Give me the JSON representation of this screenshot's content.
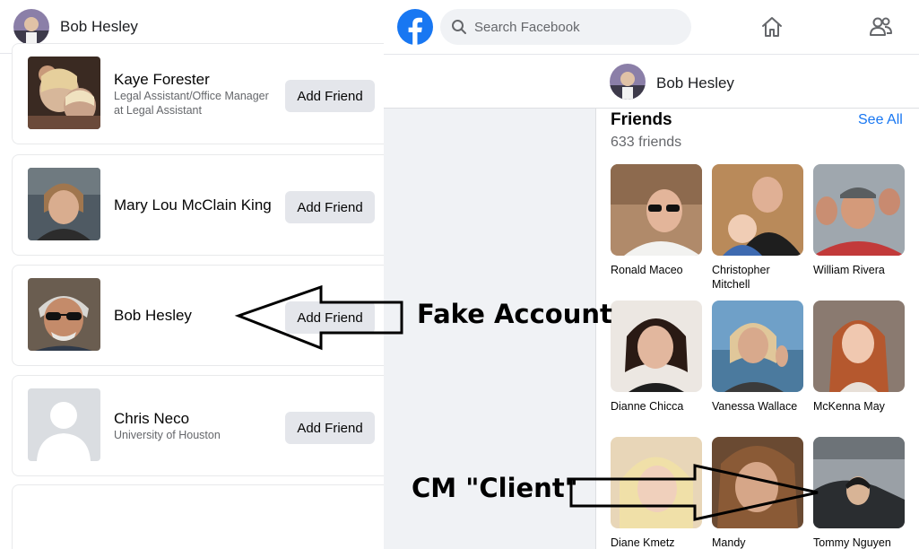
{
  "left_panel": {
    "header": {
      "name": "Bob Hesley"
    },
    "suggestions": [
      {
        "name": "Kaye Forester",
        "subtitle": "Legal Assistant/Office Manager at Legal Assistant",
        "button": "Add Friend"
      },
      {
        "name": "Mary Lou McClain King",
        "subtitle": "",
        "button": "Add Friend"
      },
      {
        "name": "Bob Hesley",
        "subtitle": "",
        "button": "Add Friend"
      },
      {
        "name": "Chris Neco",
        "subtitle": "University of Houston",
        "button": "Add Friend"
      }
    ]
  },
  "topbar": {
    "logo_icon": "facebook-logo",
    "search_placeholder": "Search Facebook",
    "icons": [
      "search-icon",
      "home-icon",
      "friends-icon"
    ]
  },
  "profile": {
    "name": "Bob Hesley"
  },
  "friends_section": {
    "title": "Friends",
    "count": "633 friends",
    "see_all": "See All",
    "friends": [
      {
        "name": "Ronald Maceo"
      },
      {
        "name": "Christopher Mitchell"
      },
      {
        "name": "William Rivera"
      },
      {
        "name": "Dianne Chicca"
      },
      {
        "name": "Vanessa Wallace"
      },
      {
        "name": "McKenna May"
      },
      {
        "name": "Diane Kmetz"
      },
      {
        "name": "Mandy"
      },
      {
        "name": "Tommy Nguyen"
      }
    ]
  },
  "annotations": {
    "fake_account": "Fake Account",
    "cm_client": "CM \"Client\""
  },
  "colors": {
    "facebook_blue": "#1877f2",
    "link_blue": "#1877f2",
    "button_gray": "#e4e6eb",
    "page_bg": "#f0f2f5"
  }
}
